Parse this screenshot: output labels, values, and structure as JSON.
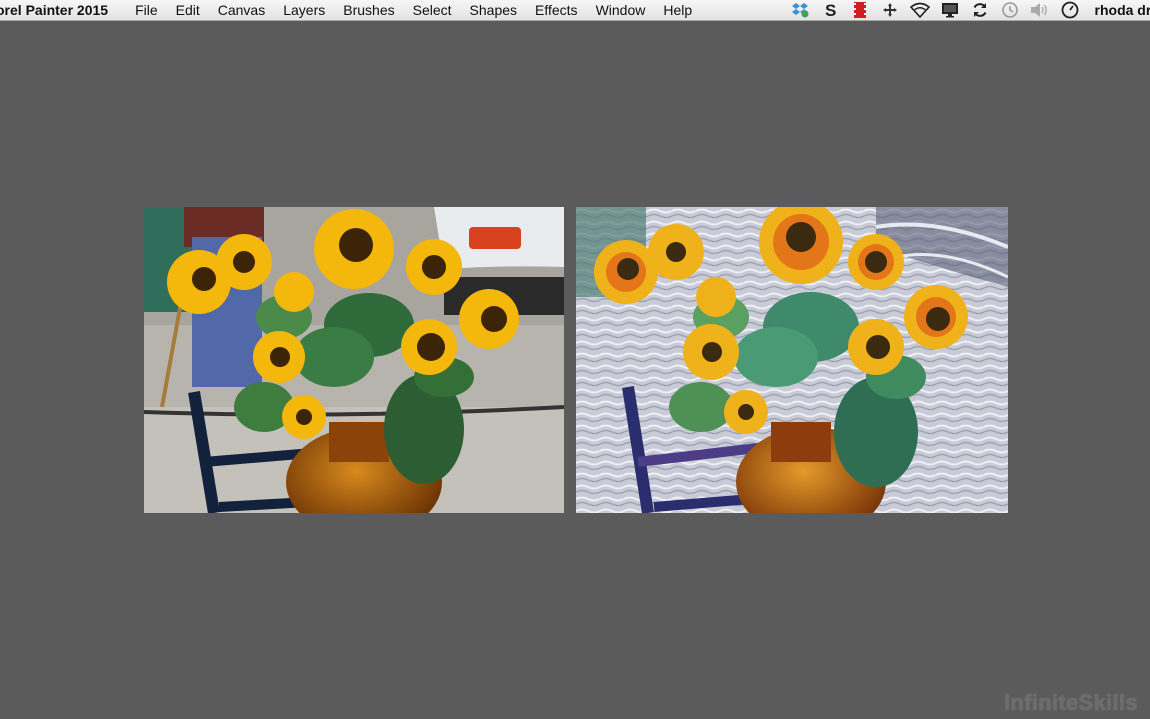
{
  "menubar": {
    "app_name": "orel Painter 2015",
    "items": [
      "File",
      "Edit",
      "Canvas",
      "Layers",
      "Brushes",
      "Select",
      "Shapes",
      "Effects",
      "Window",
      "Help"
    ],
    "status_icons": [
      "dropbox-icon",
      "skype-icon",
      "video-record-icon",
      "move-icon",
      "wifi-icon",
      "display-icon",
      "sync-icon",
      "time-machine-icon",
      "volume-icon",
      "clock-icon"
    ],
    "user_name": "rhoda draw"
  },
  "canvas": {
    "images": [
      {
        "name": "original-sunflower-photo"
      },
      {
        "name": "painted-sunflower-image"
      }
    ]
  },
  "watermark": "InfiniteSkills"
}
